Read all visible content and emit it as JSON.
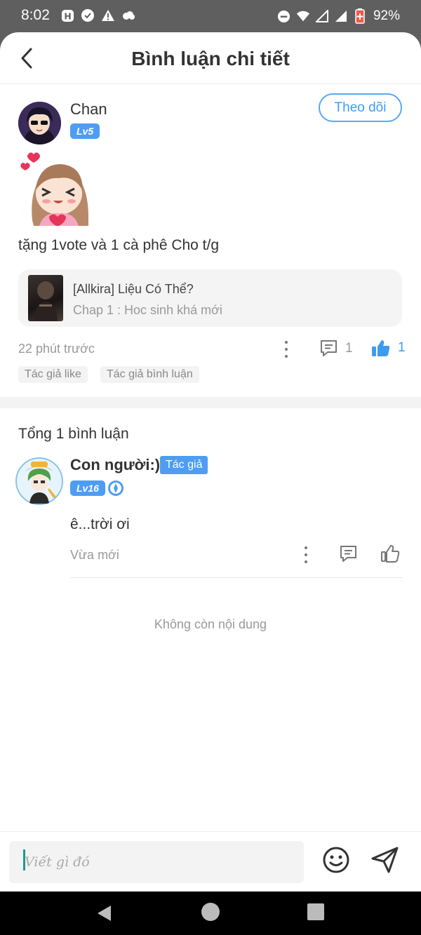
{
  "status_bar": {
    "time": "8:02",
    "battery": "92%",
    "left_icons": [
      "h-app-icon",
      "check-circle-icon",
      "warning-icon",
      "cloud-icon"
    ],
    "right_icons": [
      "do-not-disturb-icon",
      "wifi-icon",
      "signal-icon",
      "signal-icon",
      "battery-icon"
    ]
  },
  "header": {
    "title": "Bình luận chi tiết"
  },
  "main_comment": {
    "username": "Chan",
    "level": "Lv5",
    "follow_label": "Theo dõi",
    "text": "tặng 1vote và 1 cà phê Cho t/g",
    "story": {
      "title": "[Allkira] Liệu Có Thể?",
      "chapter": "Chap 1 : Hoc sinh khá mới"
    },
    "time": "22 phút trước",
    "reply_count": "1",
    "like_count": "1",
    "tags": [
      "Tác giả like",
      "Tác giả bình luận"
    ]
  },
  "replies": {
    "total_label": "Tổng 1 bình luận",
    "items": [
      {
        "username": "Con người:)",
        "author_badge": "Tác giả",
        "level": "Lv16",
        "text": "ê...trời ơi",
        "time": "Vừa mới"
      }
    ],
    "end_label": "Không còn nội dung"
  },
  "composer": {
    "placeholder": "Viết gì đó"
  },
  "colors": {
    "accent": "#3d9cf0",
    "badge": "#4e9df3",
    "status_bar": "#5f5f5f"
  }
}
